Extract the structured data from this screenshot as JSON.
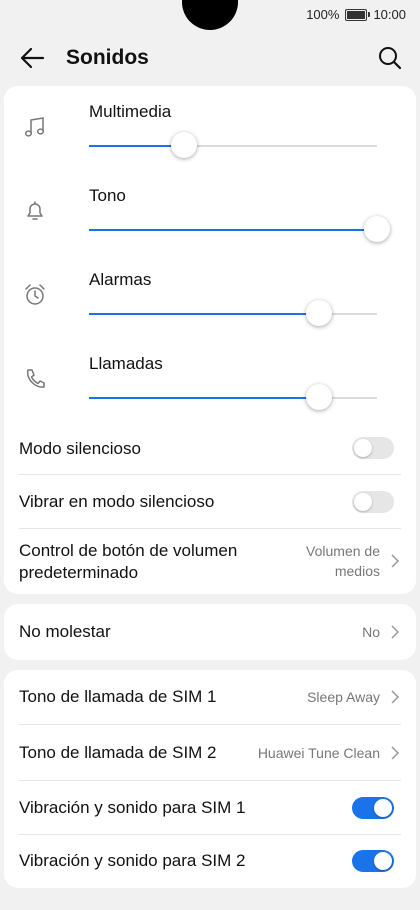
{
  "status": {
    "battery": "100%",
    "time": "10:00"
  },
  "header": {
    "title": "Sonidos"
  },
  "volumes": [
    {
      "label": "Multimedia",
      "icon": "music-note-icon",
      "level": 0.33
    },
    {
      "label": "Tono",
      "icon": "bell-icon",
      "level": 1.0
    },
    {
      "label": "Alarmas",
      "icon": "alarm-clock-icon",
      "level": 0.8
    },
    {
      "label": "Llamadas",
      "icon": "phone-icon",
      "level": 0.8
    }
  ],
  "settings": {
    "silent_mode": {
      "label": "Modo silencioso",
      "on": false
    },
    "vibrate_silent": {
      "label": "Vibrar en modo silencioso",
      "on": false
    },
    "volume_button": {
      "label_line1": "Control de botón de volumen",
      "label_line2": "predeterminado",
      "value_line1": "Volumen de",
      "value_line2": "medios"
    },
    "dnd": {
      "label": "No molestar",
      "value": "No"
    },
    "ringtone_sim1": {
      "label": "Tono de llamada de SIM 1",
      "value": "Sleep Away"
    },
    "ringtone_sim2": {
      "label": "Tono de llamada de SIM 2",
      "value": "Huawei Tune Clean"
    },
    "vib_sim1": {
      "label": "Vibración y sonido para SIM 1",
      "on": true
    },
    "vib_sim2": {
      "label": "Vibración y sonido para SIM 2",
      "on": true
    }
  },
  "colors": {
    "accent": "#1a73e8",
    "background": "#f1f1f1"
  }
}
